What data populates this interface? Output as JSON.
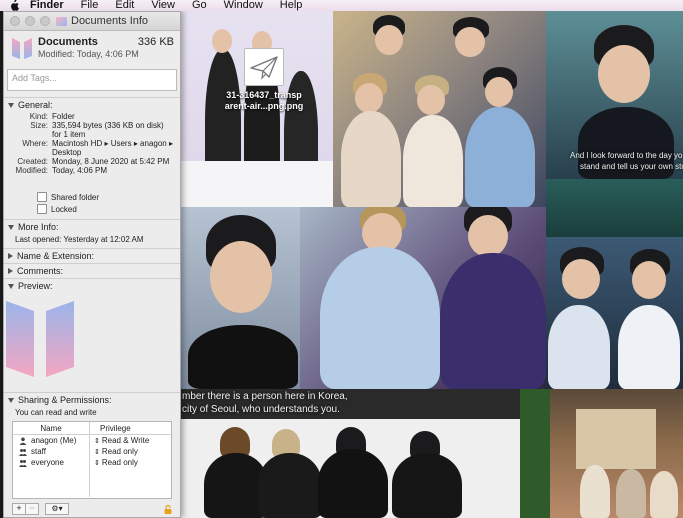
{
  "menubar": {
    "app": "Finder",
    "items": [
      "File",
      "Edit",
      "View",
      "Go",
      "Window",
      "Help"
    ]
  },
  "desktop_icon": {
    "label_line1": "31-316437_transp",
    "label_line2": "arent-air...png.png"
  },
  "wallpaper": {
    "subtitle_top_right_1": "And I look forward to the day you",
    "subtitle_top_right_2": "stand and tell us your own sto",
    "subtitle_mid_1": "mber there is a person here in Korea,",
    "subtitle_mid_2": "city of Seoul, who understands you."
  },
  "info_window": {
    "title": "Documents Info",
    "name": "Documents",
    "size": "336 KB",
    "modified_header": "Modified: Today, 4:06 PM",
    "tags_placeholder": "Add Tags...",
    "general": {
      "header": "General:",
      "rows": [
        {
          "key": "Kind:",
          "value": "Folder"
        },
        {
          "key": "Size:",
          "value": "335,594 bytes (336 KB on disk)"
        },
        {
          "key": "",
          "value": "for 1 item"
        },
        {
          "key": "Where:",
          "value": "Macintosh HD ▸ Users ▸ anagon ▸"
        },
        {
          "key": "",
          "value": "Desktop"
        },
        {
          "key": "Created:",
          "value": "Monday, 8 June 2020 at 5:42 PM"
        },
        {
          "key": "Modified:",
          "value": "Today, 4:06 PM"
        }
      ],
      "shared_folder": "Shared folder",
      "locked": "Locked"
    },
    "more_info": {
      "header": "More Info:",
      "last_opened": "Last opened: Yesterday at 12:02 AM"
    },
    "name_extension": "Name & Extension:",
    "comments": "Comments:",
    "preview": "Preview:",
    "sharing": {
      "header": "Sharing & Permissions:",
      "note": "You can read and write",
      "col_name": "Name",
      "col_privilege": "Privilege",
      "rows": [
        {
          "name": "anagon (Me)",
          "privilege": "Read & Write",
          "icon": "user-icon"
        },
        {
          "name": "staff",
          "privilege": "Read only",
          "icon": "group-icon"
        },
        {
          "name": "everyone",
          "privilege": "Read only",
          "icon": "group-icon"
        }
      ],
      "add": "+",
      "remove": "−",
      "gear": "⚙▾"
    }
  },
  "colors": {
    "menubar": "#f3e8f3",
    "window_bg": "#ececec",
    "folder_gradient_top": "#f4a6c2",
    "folder_gradient_bottom": "#9ab5ea",
    "lock": "#e6a21b"
  }
}
